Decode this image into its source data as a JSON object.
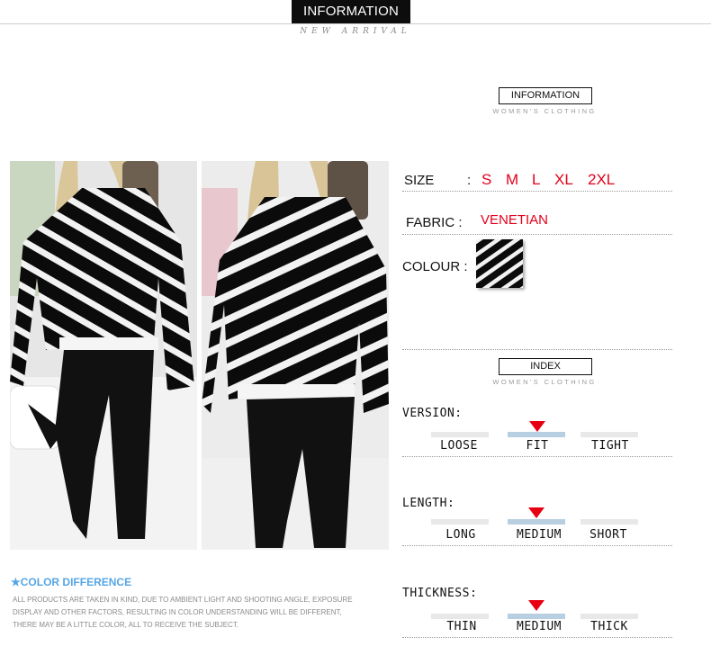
{
  "header": {
    "title": "INFORMATION",
    "subtitle": "NEW ARRIVAL"
  },
  "info_section": {
    "title": "INFORMATION",
    "subtitle": "WOMEN'S CLOTHING"
  },
  "details": {
    "size_label": "SIZE",
    "size_sep": ":",
    "sizes": [
      "S",
      "M",
      "L",
      "XL",
      "2XL"
    ],
    "fabric_label": "FABRIC :",
    "fabric_value": "VENETIAN",
    "colour_label": "COLOUR :"
  },
  "index_section": {
    "title": "INDEX",
    "subtitle": "WOMEN'S CLOTHING"
  },
  "index": {
    "version": {
      "label": "VERSION:",
      "options": [
        "LOOSE",
        "FIT",
        "TIGHT"
      ],
      "selected": "FIT"
    },
    "length": {
      "label": "LENGTH:",
      "options": [
        "LONG",
        "MEDIUM",
        "SHORT"
      ],
      "selected": "MEDIUM"
    },
    "thickness": {
      "label": "THICKNESS:",
      "options": [
        "THIN",
        "MEDIUM",
        "THICK"
      ],
      "selected": "MEDIUM"
    }
  },
  "color_difference": {
    "title": "★COLOR DIFFERENCE",
    "lines": [
      "ALL PRODUCTS ARE TAKEN IN KIND, DUE TO AMBIENT LIGHT AND SHOOTING ANGLE, EXPOSURE",
      "DISPLAY AND OTHER FACTORS, RESULTING IN COLOR UNDERSTANDING WILL BE DIFFERENT,",
      "THERE MAY BE A LITTLE COLOR, ALL TO RECEIVE THE SUBJECT."
    ]
  },
  "colors": {
    "accent_red": "#e3001b",
    "marker_red": "#e60012",
    "selected_bar": "#b7cfe0",
    "note_blue": "#55a6e6"
  }
}
